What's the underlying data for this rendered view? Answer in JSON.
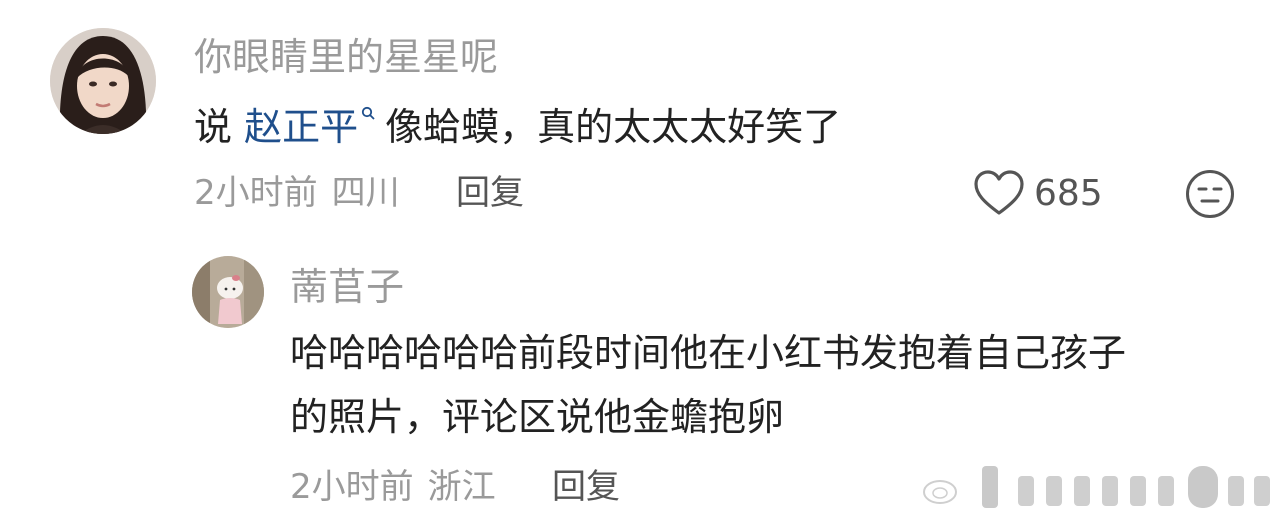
{
  "comment": {
    "username": "你眼睛里的星星呢",
    "text_before": "说",
    "mention": "赵正平",
    "text_after": "像蛤蟆，真的太太太好笑了",
    "time": "2小时前",
    "location": "四川",
    "reply_label": "回复",
    "like_count": "685"
  },
  "reply": {
    "username": "萳苢子",
    "text_line1": "哈哈哈哈哈哈前段时间他在小红书发抱着自己孩子",
    "text_line2": "的照片，评论区说他金蟾抱卵",
    "time": "2小时前",
    "location": "浙江",
    "reply_label": "回复"
  },
  "colors": {
    "meta_text": "#9a9a9a",
    "body_text": "#222222",
    "mention": "#1f4f8c"
  },
  "icons": {
    "like": "heart-outline-icon",
    "emoji": "neutral-face-icon",
    "mention": "search-icon"
  }
}
